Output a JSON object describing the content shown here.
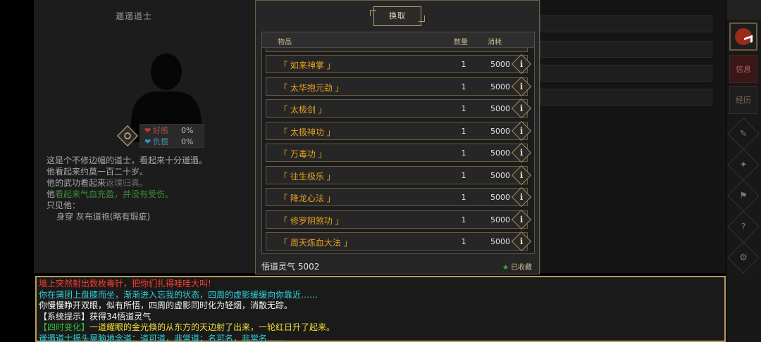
{
  "npc": {
    "name": "邋遢道士",
    "stats": [
      {
        "icon": "heart-icon",
        "label": "好感",
        "value": "0%"
      },
      {
        "icon": "heart-icon",
        "label": "仇恨",
        "value": "0%"
      }
    ],
    "description": [
      "这是个不修边幅的道士，看起来十分邋遢。",
      "他看起来约莫一百二十岁。",
      "他的武功看起来",
      "返璞归真。",
      "他",
      "看起来气血充盈，并没有受伤。",
      "只见他：",
      "身穿 灰布道袍(略有瑕疵)"
    ]
  },
  "sidebar": {
    "tabs": [
      "信息",
      "经历"
    ],
    "icons": [
      "share-icon",
      "craft-icon",
      "study-icon",
      "sect-icon",
      "help-icon",
      "settings-icon"
    ]
  },
  "exchange": {
    "title": "换取",
    "columns": {
      "item": "物品",
      "qty": "数量",
      "cost": "消耗"
    },
    "items": [
      {
        "name": "「 如来神掌 」",
        "qty": "1",
        "cost": "5000"
      },
      {
        "name": "「 太华抱元劲 」",
        "qty": "1",
        "cost": "5000"
      },
      {
        "name": "「 太极剑 」",
        "qty": "1",
        "cost": "5000"
      },
      {
        "name": "「 太极神功 」",
        "qty": "1",
        "cost": "5000"
      },
      {
        "name": "「 万毒功 」",
        "qty": "1",
        "cost": "5000"
      },
      {
        "name": "「 往生极乐 」",
        "qty": "1",
        "cost": "5000"
      },
      {
        "name": "「 降龙心法 」",
        "qty": "1",
        "cost": "5000"
      },
      {
        "name": "「 修罗阴煞功 」",
        "qty": "1",
        "cost": "5000"
      },
      {
        "name": "「 周天炼血大法 」",
        "qty": "1",
        "cost": "5000"
      }
    ],
    "info_glyph": "i",
    "currency_label": "悟道灵气 5002",
    "favorite_label": "已收藏"
  },
  "log": {
    "lines": [
      {
        "text": "墙上突然射出数枚毒针，把你们扎得哇哇大叫!",
        "color": "red"
      },
      {
        "text": "你在蒲团上盘膝而坐，渐渐进入忘我的状态，四周的虚影缓缓向你靠近……",
        "color": "cyan"
      },
      {
        "text": "你慢慢睁开双眼，似有所悟，四周的虚影同时化为轻烟，消散无踪。",
        "color": "white"
      },
      {
        "text": "【系统提示】获得34悟道灵气",
        "color": "white"
      },
      {
        "prefix": "【四时变化】",
        "text": "一道耀眼的金光倏的从东方的天边射了出来，一轮红日升了起来。",
        "color": "yellow"
      },
      {
        "text": "邋遢道士摇头晃脑地念道：道可道，非常道；名可名，非常名……",
        "color": "cyan"
      }
    ]
  }
}
